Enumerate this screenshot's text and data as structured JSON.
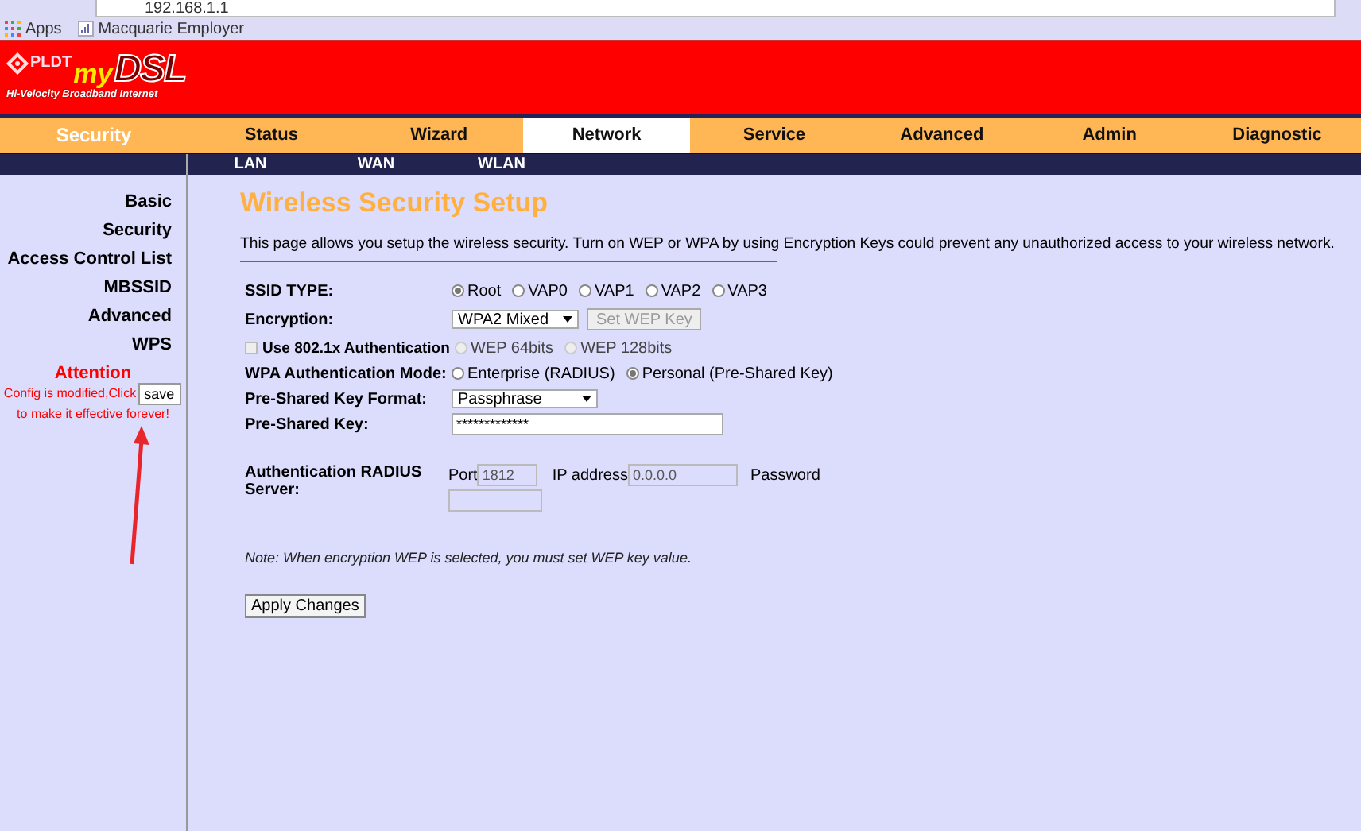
{
  "browser": {
    "address": "192.168.1.1",
    "bookmarks": [
      {
        "kind": "apps",
        "label": "Apps"
      },
      {
        "kind": "page",
        "label": "Macquarie Employer"
      }
    ]
  },
  "logo": {
    "brand": "PLDT",
    "name_prefix": "my",
    "name": "DSL",
    "tagline": "Hi-Velocity Broadband Internet"
  },
  "nav": {
    "section": "Security",
    "tabs": [
      {
        "label": "Status",
        "selected": false
      },
      {
        "label": "Wizard",
        "selected": false
      },
      {
        "label": "Network",
        "selected": true
      },
      {
        "label": "Service",
        "selected": false
      },
      {
        "label": "Advanced",
        "selected": false
      },
      {
        "label": "Admin",
        "selected": false
      },
      {
        "label": "Diagnostic",
        "selected": false
      }
    ]
  },
  "subnav": [
    "LAN",
    "WAN",
    "WLAN"
  ],
  "sidebar": {
    "items": [
      "Basic",
      "Security",
      "Access Control List",
      "MBSSID",
      "Advanced",
      "WPS"
    ],
    "attention": {
      "title": "Attention",
      "text_before": "Config is modified,Click",
      "button": "save",
      "text_after": "to make it effective forever!"
    }
  },
  "main": {
    "title": "Wireless Security Setup",
    "description": "This page allows you setup the wireless security. Turn on WEP or WPA by using Encryption Keys could prevent any unauthorized access to your wireless network.",
    "ssid_type": {
      "label": "SSID TYPE:",
      "options": [
        {
          "label": "Root",
          "selected": true
        },
        {
          "label": "VAP0",
          "selected": false
        },
        {
          "label": "VAP1",
          "selected": false
        },
        {
          "label": "VAP2",
          "selected": false
        },
        {
          "label": "VAP3",
          "selected": false
        }
      ]
    },
    "encryption": {
      "label": "Encryption:",
      "value": "WPA2 Mixed",
      "button": {
        "label": "Set WEP Key",
        "disabled": true
      }
    },
    "dot1x": {
      "label": "Use 802.1x Authentication",
      "checked": false,
      "disabled": true
    },
    "wep_key_length": {
      "disabled": true,
      "options": [
        {
          "label": "WEP 64bits",
          "selected": false
        },
        {
          "label": "WEP 128bits",
          "selected": false
        }
      ]
    },
    "wpa_mode": {
      "label": "WPA Authentication Mode:",
      "options": [
        {
          "label": "Enterprise (RADIUS)",
          "selected": false
        },
        {
          "label": "Personal (Pre-Shared Key)",
          "selected": true
        }
      ]
    },
    "psk_format": {
      "label": "Pre-Shared Key Format:",
      "value": "Passphrase"
    },
    "psk": {
      "label": "Pre-Shared Key:",
      "value": "*************"
    },
    "radius": {
      "label": "Authentication RADIUS Server:",
      "disabled": true,
      "port": {
        "label": "Port",
        "value": "1812"
      },
      "ip": {
        "label": "IP address",
        "value": "0.0.0.0"
      },
      "password": {
        "label": "Password"
      }
    },
    "note": "Note: When encryption WEP is selected, you must set WEP key value.",
    "apply_button": "Apply Changes"
  }
}
